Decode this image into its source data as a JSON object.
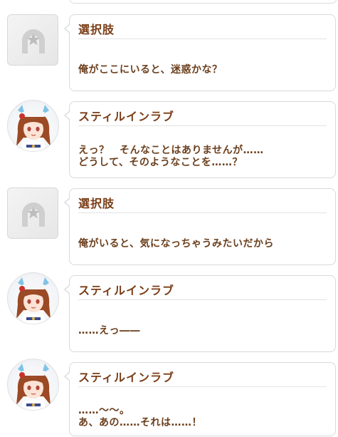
{
  "dialogue": [
    {
      "speaker": "選択肢",
      "kind": "choice",
      "lines": [
        "俺がここにいると、迷惑かな？"
      ]
    },
    {
      "speaker": "スティルインラブ",
      "kind": "character",
      "lines": [
        "えっ？　そんなことはありませんが……",
        "どうして、そのようなことを……？"
      ]
    },
    {
      "speaker": "選択肢",
      "kind": "choice",
      "lines": [
        "俺がいると、気になっちゃうみたいだから"
      ]
    },
    {
      "speaker": "スティルインラブ",
      "kind": "character",
      "lines": [
        "……えっ――"
      ]
    },
    {
      "speaker": "スティルインラブ",
      "kind": "character",
      "lines": [
        "……～～。",
        "あ、あの……それは……！"
      ]
    }
  ],
  "colors": {
    "speaker_text": "#7a3d16",
    "body_text": "#6b3f1d",
    "bubble_border": "#d9d9d9"
  },
  "icons": {
    "choice_avatar": "horseshoe-star-icon",
    "character_avatar": "character-portrait"
  }
}
